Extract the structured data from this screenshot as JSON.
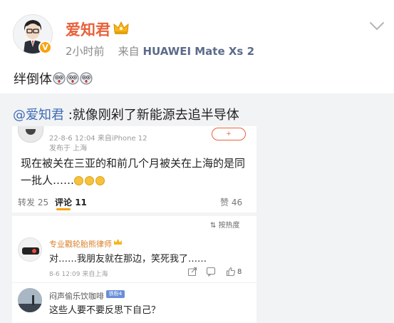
{
  "post": {
    "author": "爱知君",
    "time": "2小时前",
    "source_prefix": "来自",
    "source_device": "HUAWEI Mate Xs 2",
    "text": "绊倒体"
  },
  "repost": {
    "mention": "@爱知君",
    "text": " :就像刚剁了新能源去追半导体"
  },
  "screenshot": {
    "header_time": "22-8-6 12:04  来自iPhone 12",
    "header_location": "发布于 上海",
    "body_line1": "现在被关在三亚的和前几个月被关在上海的是同",
    "body_line2": "一批人……",
    "tabs": [
      {
        "label": "转发",
        "count": "25"
      },
      {
        "label": "评论",
        "count": "11"
      },
      {
        "label": "赞",
        "count": "46"
      }
    ],
    "sort_label": "按热度",
    "comments": [
      {
        "name": "专业戳轮胎熊律师",
        "text": "对……我朋友就在那边，笑死我了……",
        "time": "8-6 12:09  来自上海",
        "likes": "8"
      },
      {
        "name": "闷声偷乐饮咖啡",
        "badge": "铁粉4",
        "text": "这些人要不要反思下自己？"
      }
    ]
  },
  "colors": {
    "author": "#e8623b",
    "mention": "#3e6bb3",
    "repost_bg": "#f2f3f5",
    "vip_badge": "#f7a312"
  },
  "icons": [
    "avatar",
    "v-badge",
    "crown-icon",
    "chevron-down-icon",
    "laughing-emoji-icon",
    "share-icon",
    "comment-icon",
    "like-icon"
  ]
}
